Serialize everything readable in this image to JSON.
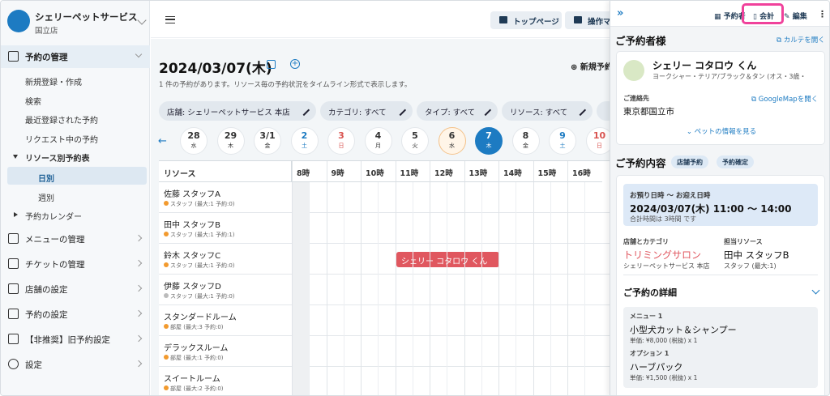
{
  "app": {
    "brand": "シェリーペットサービス",
    "store": "国立店"
  },
  "colors": {
    "primary": "#1d7bc2",
    "booking": "#e0575f",
    "highlight": "#f0419b"
  },
  "sidebar": {
    "reservations": {
      "label": "予約の管理",
      "icon": "calendar-icon"
    },
    "sub": [
      "新規登録・作成",
      "検索",
      "最近登録された予約",
      "リクエスト中の予約"
    ],
    "resource_table": "リソース別予約表",
    "daily": "日別",
    "weekly": "週別",
    "calendar": "予約カレンダー",
    "sections": [
      {
        "label": "メニューの管理",
        "icon": "list-icon"
      },
      {
        "label": "チケットの管理",
        "icon": "ticket-icon"
      },
      {
        "label": "店舗の設定",
        "icon": "home-icon"
      },
      {
        "label": "予約の設定",
        "icon": "edit-icon"
      },
      {
        "label": "【非推奨】旧予約設定",
        "icon": "edit-icon"
      },
      {
        "label": "設定",
        "icon": "gear-icon"
      }
    ]
  },
  "topbar": {
    "top_page": "トップページ",
    "manual": "操作マニ"
  },
  "main": {
    "date": "2024/03/07(木)",
    "new_button": "新規予約",
    "description": "1 件の予約があります。リソース毎の予約状況をタイムライン形式で表示します。",
    "filters": [
      {
        "label": "店舗: シェリーペットサービス 本店"
      },
      {
        "label": "カテゴリ: すべて"
      },
      {
        "label": "タイプ: すべて"
      },
      {
        "label": "リソース: すべて"
      }
    ],
    "days": [
      {
        "n": "28",
        "w": "水",
        "kind": ""
      },
      {
        "n": "29",
        "w": "木",
        "kind": ""
      },
      {
        "n": "3/1",
        "w": "金",
        "kind": ""
      },
      {
        "n": "2",
        "w": "土",
        "kind": "blue"
      },
      {
        "n": "3",
        "w": "日",
        "kind": "red"
      },
      {
        "n": "4",
        "w": "月",
        "kind": ""
      },
      {
        "n": "5",
        "w": "火",
        "kind": ""
      },
      {
        "n": "6",
        "w": "水",
        "kind": "wed"
      },
      {
        "n": "7",
        "w": "木",
        "kind": "sel"
      },
      {
        "n": "8",
        "w": "金",
        "kind": ""
      },
      {
        "n": "9",
        "w": "土",
        "kind": "blue"
      },
      {
        "n": "10",
        "w": "日",
        "kind": "red"
      }
    ],
    "grid": {
      "resource_header": "リソース",
      "hours": [
        "8時",
        "9時",
        "10時",
        "11時",
        "12時",
        "13時",
        "14時",
        "15時",
        "16時"
      ],
      "rows": [
        {
          "name": "佐藤 スタッフA",
          "sub": "スタッフ (最大:1 予約:0)",
          "dot": "orange"
        },
        {
          "name": "田中 スタッフB",
          "sub": "スタッフ (最大:1 予約:1)",
          "dot": "orange"
        },
        {
          "name": "鈴木 スタッフC",
          "sub": "スタッフ (最大:1 予約:0)",
          "dot": "orange"
        },
        {
          "name": "伊藤 スタッフD",
          "sub": "スタッフ (最大:1 予約:0)",
          "dot": "gray"
        },
        {
          "name": "スタンダードルーム",
          "sub": "部屋 (最大:3 予約:0)",
          "dot": "orange"
        },
        {
          "name": "デラックスルーム",
          "sub": "部屋 (最大:1 予約:0)",
          "dot": "orange"
        },
        {
          "name": "スイートルーム",
          "sub": "部屋 (最大:2 予約:0)",
          "dot": "orange"
        }
      ],
      "booking": "シェリー コタロウ くん"
    }
  },
  "panel": {
    "tabs": {
      "reservation": "予約者",
      "checkout": "会計",
      "edit": "編集"
    },
    "customer_title": "ご予約者様",
    "karte_link": "カルテを開く",
    "pet_name": "シェリー コタロウ くん",
    "pet_desc": "ヨークシャー・テリア/ブラック＆タン (オス・3歳・",
    "contact_label": "ご連絡先",
    "map_link": "GoogleMapを開く",
    "address": "東京都国立市",
    "pet_info_link": "ペットの情報を見る",
    "content_title": "ご予約内容",
    "tag_store": "店舗予約",
    "tag_status": "予約確定",
    "time_label": "お預り日時 〜 お迎え日時",
    "time_value": "2024/03/07(木) 11:00 〜 14:00",
    "time_total": "合計時間は 3時間 です",
    "store_cat_label": "店舗とカテゴリ",
    "category": "トリミングサロン",
    "store_name": "シェリーペットサービス 本店",
    "resource_label": "担当リソース",
    "resource_name": "田中 スタッフB",
    "resource_sub": "スタッフ (最大:1)",
    "details_title": "ご予約の詳細",
    "menu_label": "メニュー 1",
    "menu_name": "小型犬カット＆シャンプー",
    "menu_price": "単価: ¥8,000 (税抜) x 1",
    "option_label": "オプション 1",
    "option_name": "ハーブパック",
    "option_price": "単価: ¥1,500 (税抜) x 1"
  }
}
